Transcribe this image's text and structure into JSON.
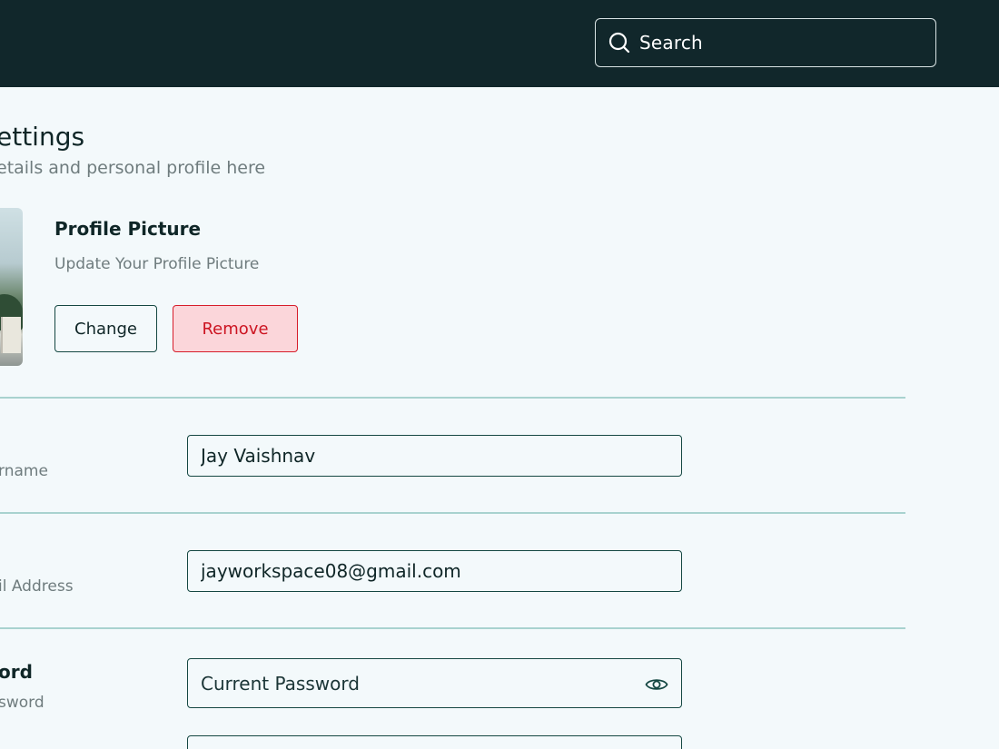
{
  "header": {
    "search_label": "Search",
    "colors": {
      "bar": "#11272b",
      "search_border": "#d9e3e4"
    }
  },
  "page": {
    "title": "ettings",
    "subtitle": "etails and personal profile here"
  },
  "profile_picture": {
    "title": "Profile Picture",
    "subtitle": "Update Your Profile Picture",
    "change_label": "Change",
    "remove_label": "Remove"
  },
  "fields": {
    "username": {
      "label": "rname",
      "value": "Jay Vaishnav"
    },
    "email": {
      "label": "il Address",
      "value": "jayworkspace08@gmail.com"
    },
    "password": {
      "title": "ord",
      "label": "sword",
      "placeholder": "Current Password"
    }
  },
  "colors": {
    "accent": "#144742",
    "danger": "#d61d2a",
    "danger_bg": "#fbd6da",
    "divider": "#a8d2cf",
    "background": "#f3f9fb"
  }
}
